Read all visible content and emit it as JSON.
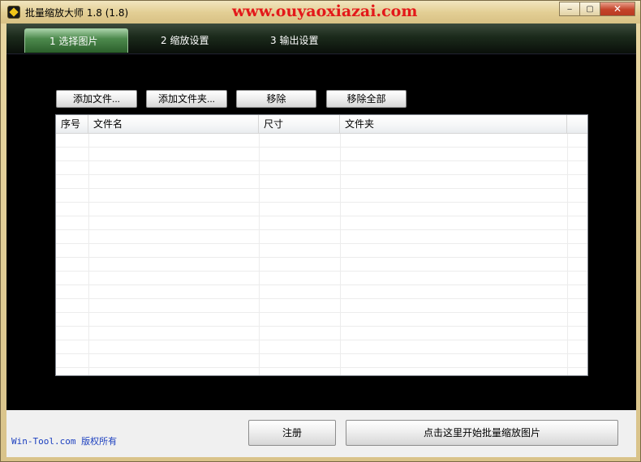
{
  "window": {
    "title": "批量缩放大师 1.8 (1.8)",
    "watermark": "www.ouyaoxiazai.com",
    "minimize_glyph": "‒",
    "maximize_glyph": "▢",
    "close_glyph": "✕"
  },
  "tabs": [
    {
      "label": "1 选择图片",
      "active": true
    },
    {
      "label": "2 缩放设置",
      "active": false
    },
    {
      "label": "3 输出设置",
      "active": false
    }
  ],
  "toolbar": {
    "add_file": "添加文件...",
    "add_folder": "添加文件夹...",
    "remove": "移除",
    "remove_all": "移除全部"
  },
  "list": {
    "columns": [
      "序号",
      "文件名",
      "尺寸",
      "文件夹",
      ""
    ],
    "rows": []
  },
  "footer": {
    "copyright": "Win-Tool.com 版权所有",
    "register": "注册",
    "start": "点击这里开始批量缩放图片"
  },
  "colors": {
    "watermark": "#e3181a",
    "copyright": "#1b3fbf",
    "active_tab": "#4d8a4d"
  }
}
